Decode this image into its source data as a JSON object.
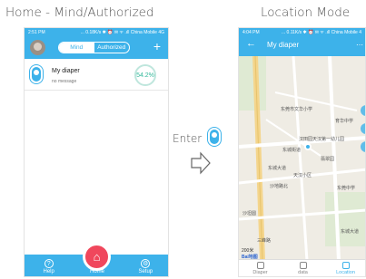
{
  "headings": {
    "left": "Home - Mind/Authorized",
    "right": "Location Mode"
  },
  "left_phone": {
    "status": {
      "time": "2:51 PM",
      "info": "... 0.18K/s ✱ ⏰ ✉ ᯤ .ıll China Mobile 4G"
    },
    "toggle": {
      "mind": "Mind",
      "authorized": "Authorized"
    },
    "add_label": "+",
    "device": {
      "name": "My diaper",
      "message": "no message",
      "percent": "54.2%"
    },
    "nav": {
      "help": "Help",
      "home": "Home",
      "setup": "Setup"
    }
  },
  "middle": {
    "enter": "Enter"
  },
  "right_phone": {
    "status": {
      "time": "4:04 PM",
      "info": "... 0.11K/s ✱ ⏰ ✉ ᯤ .ıll China Mobile 4"
    },
    "title": "My diaper",
    "map_labels": [
      "东莞市文华小学",
      "育华中学",
      "东城街道",
      "汉田园天汉第一幼儿园",
      "东城大道",
      "翡翠园",
      "天汉小区",
      "沙地路北",
      "沙坦圆",
      "东莞中学",
      "三峰路",
      "东城大道",
      "200米"
    ],
    "baidu": "Bai地图",
    "nav": {
      "diaper": "Diaper",
      "data": "data",
      "location": "Location"
    }
  },
  "colors": {
    "accent": "#3db2ea",
    "home_button": "#f0475c",
    "percent": "#31b89a"
  }
}
